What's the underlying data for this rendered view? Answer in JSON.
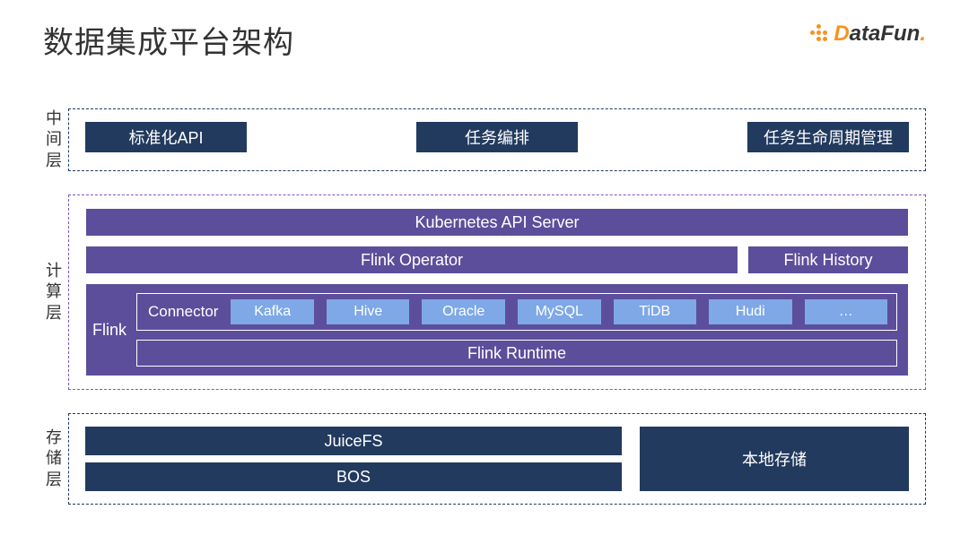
{
  "title": "数据集成平台架构",
  "logo": {
    "d": "D",
    "rest": "ataFun",
    "dot": "."
  },
  "middle": {
    "label": "中间层",
    "items": [
      "标准化API",
      "任务编排",
      "任务生命周期管理"
    ]
  },
  "compute": {
    "label": "计算层",
    "k8s": "Kubernetes API Server",
    "operator": "Flink Operator",
    "history": "Flink History",
    "flink_label": "Flink",
    "connector_label": "Connector",
    "connectors": [
      "Kafka",
      "Hive",
      "Oracle",
      "MySQL",
      "TiDB",
      "Hudi",
      "…"
    ],
    "runtime": "Flink Runtime"
  },
  "storage": {
    "label": "存储层",
    "left": [
      "JuiceFS",
      "BOS"
    ],
    "right": "本地存储"
  }
}
